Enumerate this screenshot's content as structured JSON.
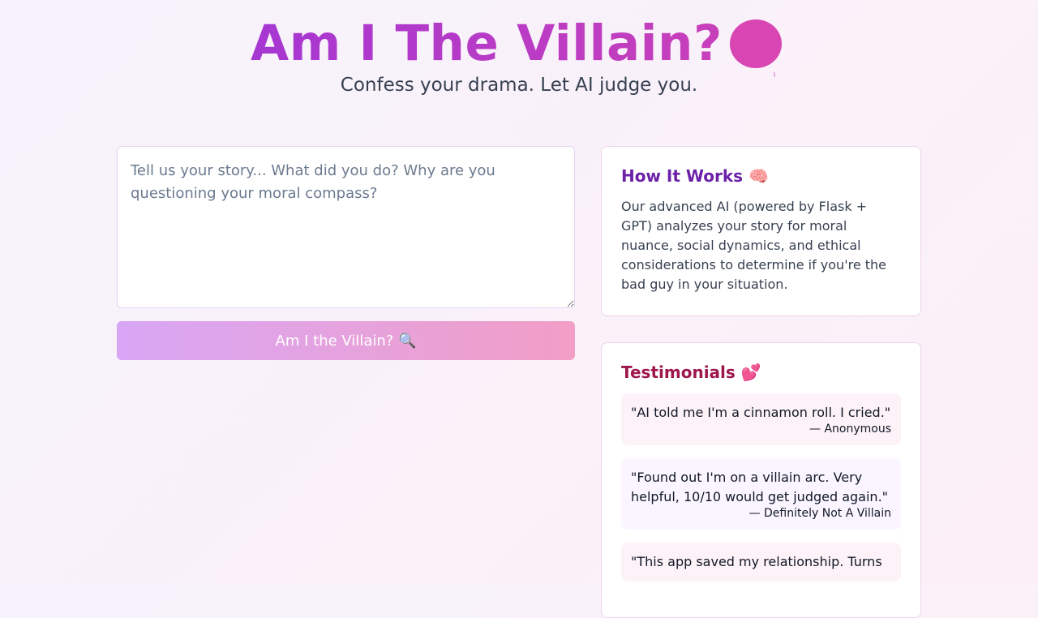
{
  "header": {
    "title": "Am I The Villain?",
    "title_icon": "devil-emoji-icon",
    "subtitle": "Confess your drama. Let AI judge you."
  },
  "form": {
    "placeholder": "Tell us your story... What did you do? Why are you questioning your moral compass?",
    "submit_label": "Am I the Villain? 🔍"
  },
  "how_it_works": {
    "title": "How It Works 🧠",
    "body": "Our advanced AI (powered by Flask + GPT) analyzes your story for moral nuance, social dynamics, and ethical considerations to determine if you're the bad guy in your situation."
  },
  "testimonials": {
    "title": "Testimonials 💕",
    "items": [
      {
        "text": "\"AI told me I'm a cinnamon roll. I cried.\"",
        "author": "— Anonymous"
      },
      {
        "text": "\"Found out I'm on a villain arc. Very helpful, 10/10 would get judged again.\"",
        "author": "— Definitely Not A Villain"
      },
      {
        "text": "\"This app saved my relationship. Turns",
        "author": ""
      }
    ]
  },
  "colors": {
    "title_gradient_start": "#a637d2",
    "title_gradient_end": "#c83fba",
    "button_gradient_start": "#d8a6f5",
    "button_gradient_end": "#f29ec6",
    "how_heading": "#6b21a8",
    "testimonials_heading": "#9d174d"
  }
}
